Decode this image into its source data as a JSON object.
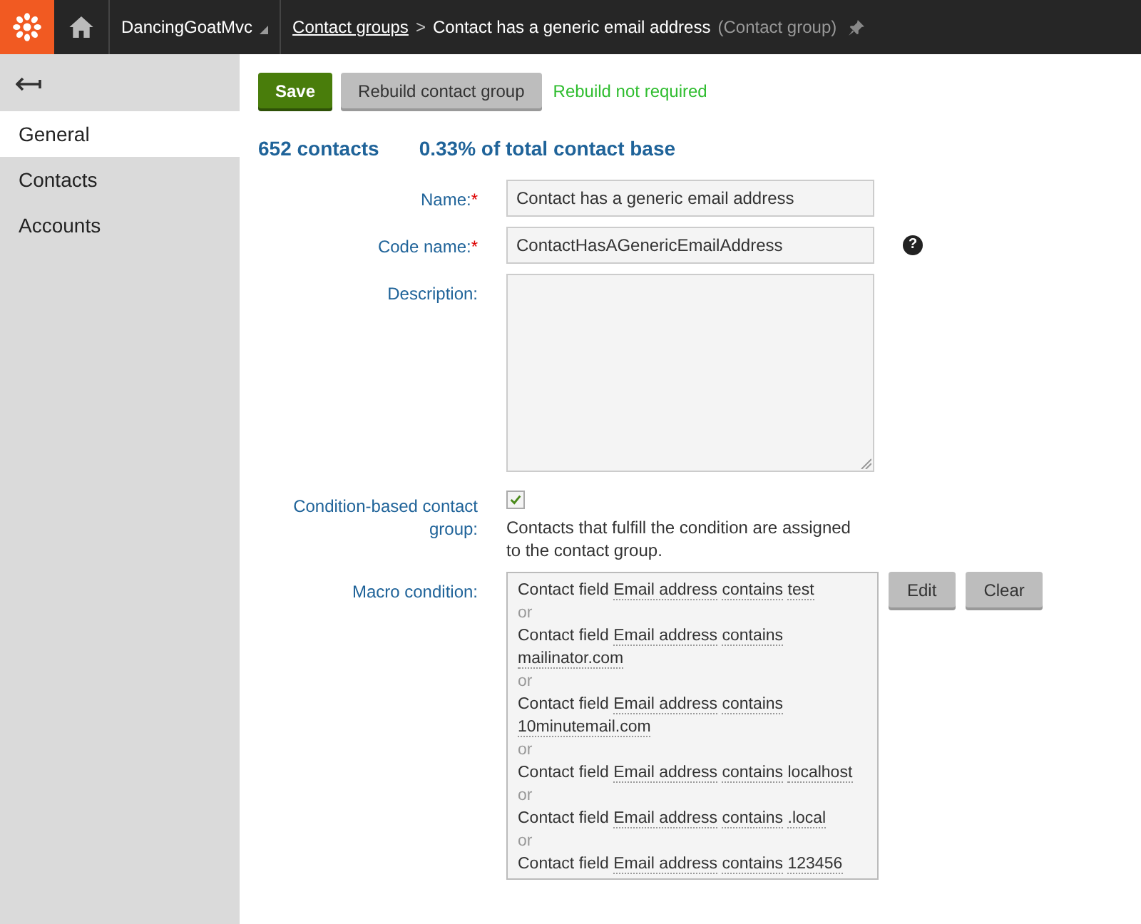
{
  "header": {
    "site": "DancingGoatMvc",
    "breadcrumb_link": "Contact groups",
    "separator": ">",
    "title": "Contact has a generic email address",
    "object_type": "(Contact group)"
  },
  "sidebar": {
    "items": [
      {
        "label": "General",
        "selected": true
      },
      {
        "label": "Contacts",
        "selected": false
      },
      {
        "label": "Accounts",
        "selected": false
      }
    ]
  },
  "toolbar": {
    "save": "Save",
    "rebuild": "Rebuild contact group",
    "status": "Rebuild not required"
  },
  "stats": {
    "contacts": "652 contacts",
    "share": "0.33% of total contact base"
  },
  "form": {
    "name": {
      "label": "Name:",
      "required_mark": "*",
      "value": "Contact has a generic email address"
    },
    "code_name": {
      "label": "Code name:",
      "required_mark": "*",
      "value": "ContactHasAGenericEmailAddress",
      "help": "?"
    },
    "description": {
      "label": "Description:"
    },
    "condition_based": {
      "label": "Condition-based contact group:",
      "checked": true,
      "note": "Contacts that fulfill the condition are assigned to the contact group."
    },
    "macro": {
      "label": "Macro condition:",
      "edit": "Edit",
      "clear": "Clear",
      "lines": [
        {
          "kind": "condition",
          "prefix": "Contact field",
          "field": "Email address",
          "operator": "contains",
          "value": "test"
        },
        {
          "kind": "joiner",
          "text": "or"
        },
        {
          "kind": "condition",
          "prefix": "Contact field",
          "field": "Email address",
          "operator": "contains",
          "value": "mailinator.com"
        },
        {
          "kind": "joiner",
          "text": "or"
        },
        {
          "kind": "condition",
          "prefix": "Contact field",
          "field": "Email address",
          "operator": "contains",
          "value": "10minutemail.com"
        },
        {
          "kind": "joiner",
          "text": "or"
        },
        {
          "kind": "condition",
          "prefix": "Contact field",
          "field": "Email address",
          "operator": "contains",
          "value": "localhost"
        },
        {
          "kind": "joiner",
          "text": "or"
        },
        {
          "kind": "condition",
          "prefix": "Contact field",
          "field": "Email address",
          "operator": "contains",
          "value": ".local"
        },
        {
          "kind": "joiner",
          "text": "or"
        },
        {
          "kind": "condition",
          "prefix": "Contact field",
          "field": "Email address",
          "operator": "contains",
          "value": "123456"
        }
      ]
    }
  }
}
